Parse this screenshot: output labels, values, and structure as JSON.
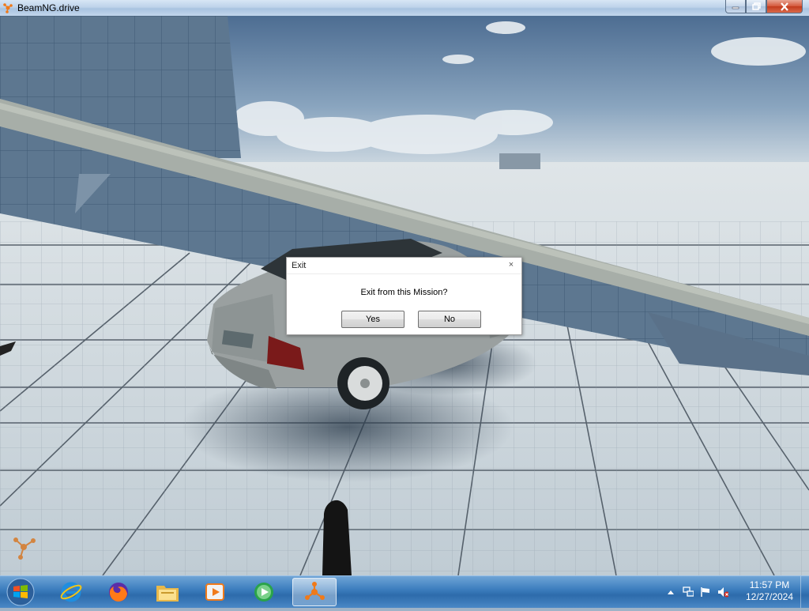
{
  "window": {
    "title": "BeamNG.drive",
    "icon": "beamng-icon",
    "controls": [
      "minimize-icon",
      "maximize-icon",
      "close-icon"
    ]
  },
  "dialog": {
    "title": "Exit",
    "close_glyph": "×",
    "message": "Exit from this Mission?",
    "yes_label": "Yes",
    "no_label": "No"
  },
  "taskbar": {
    "start_icon": "windows-start-icon",
    "items": [
      {
        "icon": "internet-explorer-icon",
        "active": false
      },
      {
        "icon": "firefox-icon",
        "active": false
      },
      {
        "icon": "file-explorer-icon",
        "active": false
      },
      {
        "icon": "media-player-icon",
        "active": false
      },
      {
        "icon": "media-center-icon",
        "active": false
      },
      {
        "icon": "beamng-icon",
        "active": true
      }
    ],
    "tray_icons": [
      "show-hidden-icons-icon",
      "network-icon",
      "action-center-flag-icon",
      "volume-muted-icon"
    ],
    "clock": {
      "time": "11:57 PM",
      "date": "12/27/2024"
    }
  },
  "colors": {
    "accent": "#3e7fbf",
    "close_button": "#c23b1d",
    "brand": "#f07a1a"
  }
}
